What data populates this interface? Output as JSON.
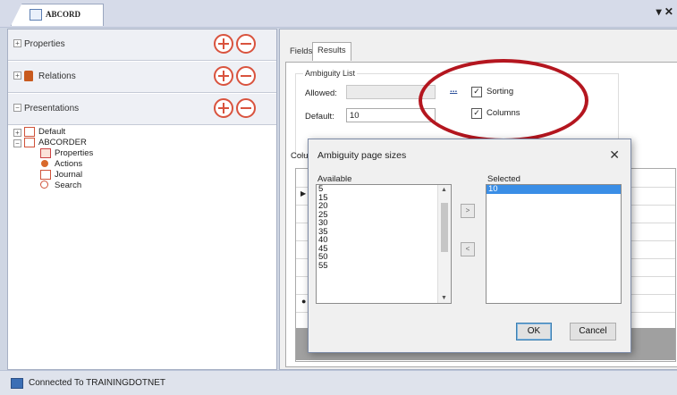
{
  "app": {
    "tab_title": "ABCORD",
    "window_control": "▾ ✕"
  },
  "left": {
    "sections": [
      {
        "label": "Properties"
      },
      {
        "label": "Relations"
      },
      {
        "label": "Presentations"
      }
    ],
    "tree": [
      {
        "label": "Default"
      },
      {
        "label": "ABCORDER"
      },
      {
        "label": "Properties"
      },
      {
        "label": "Actions"
      },
      {
        "label": "Journal"
      },
      {
        "label": "Search"
      }
    ]
  },
  "right": {
    "tabs": [
      "Fields",
      "Results"
    ],
    "group_title": "Ambiguity List",
    "allowed_label": "Allowed:",
    "allowed_value": "",
    "ellipsis_button": "...",
    "default_label": "Default:",
    "default_value": "10",
    "sorting_label": "Sorting",
    "sorting_checked": true,
    "columns_label": "Columns",
    "columns_checked": true,
    "columns_cut_label": "Colu"
  },
  "dialog": {
    "title": "Ambiguity page sizes",
    "available_label": "Available",
    "selected_label": "Selected",
    "available_items": [
      "5",
      "15",
      "20",
      "25",
      "30",
      "35",
      "40",
      "45",
      "50",
      "55"
    ],
    "selected_items": [
      "10"
    ],
    "move_right": ">",
    "move_left": "<",
    "ok_label": "OK",
    "cancel_label": "Cancel"
  },
  "status": {
    "text": "Connected To TRAININGDOTNET"
  }
}
